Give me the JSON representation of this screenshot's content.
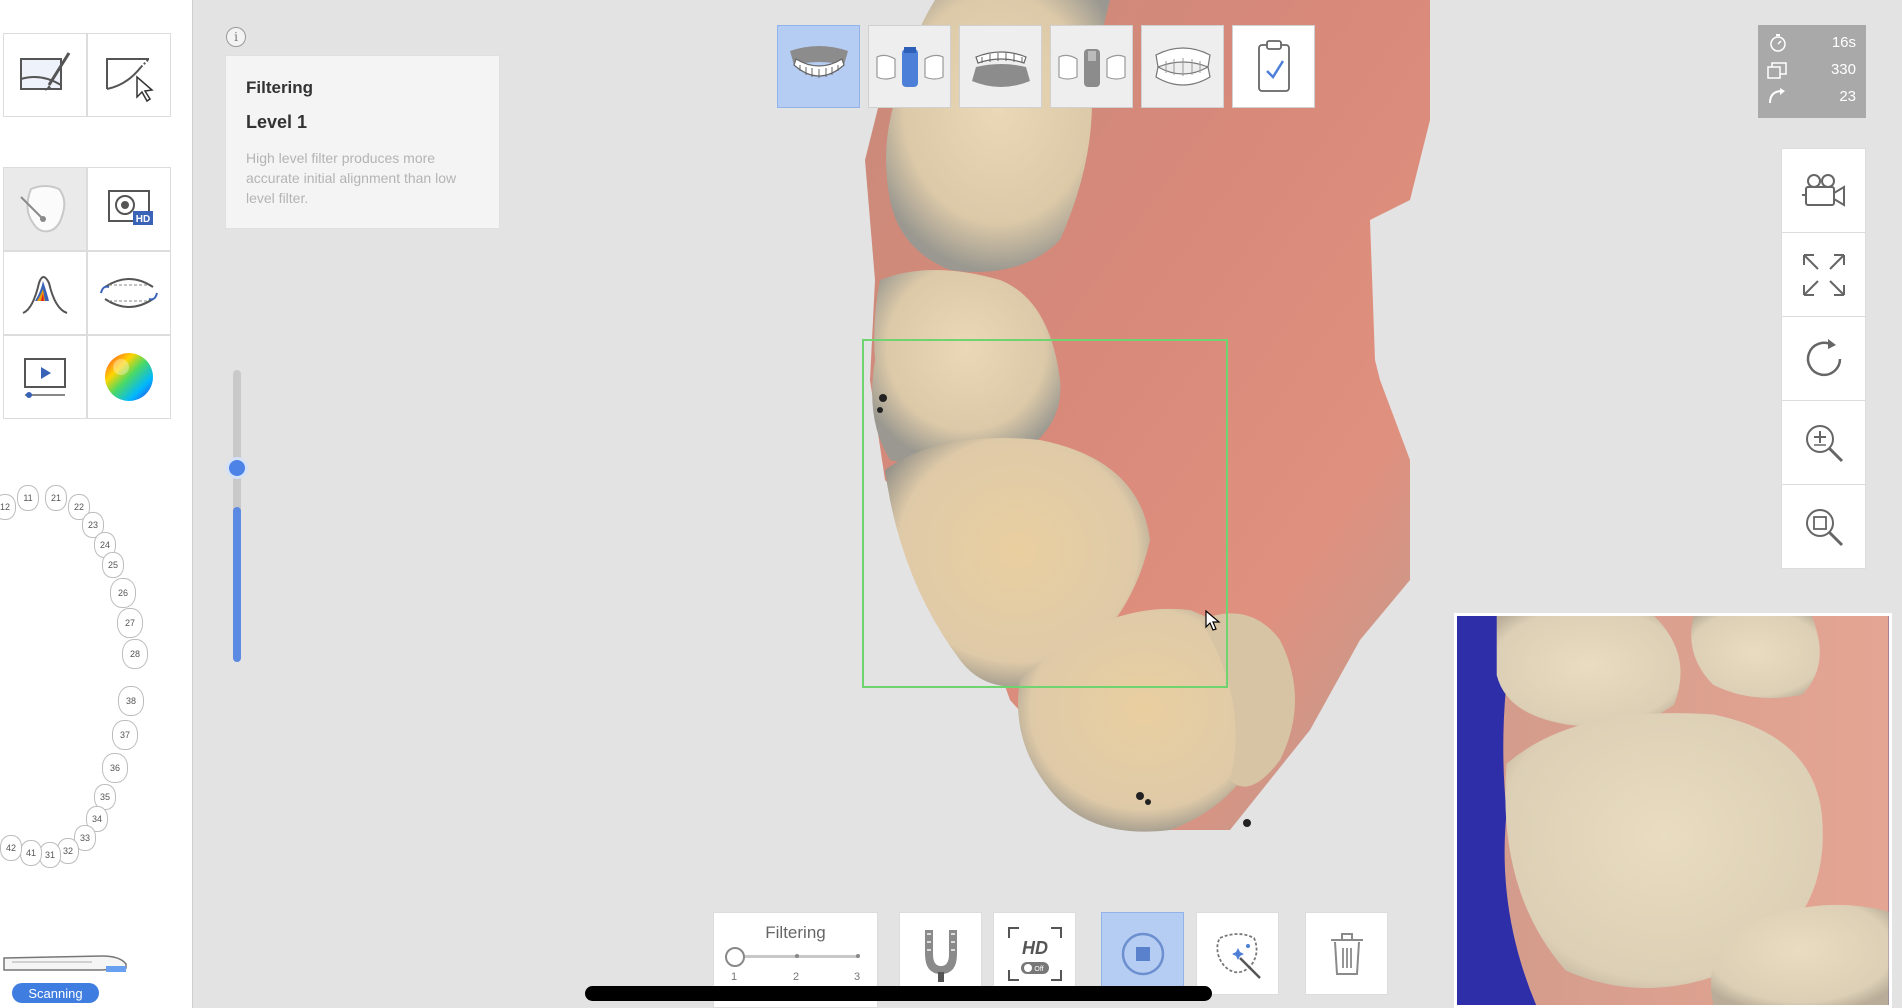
{
  "sidebar": {
    "tools": [
      {
        "icon": "edit-area-icon"
      },
      {
        "icon": "select-area-icon"
      },
      {
        "icon": "tooth-no-scan-icon"
      },
      {
        "icon": "hd-scan-icon"
      },
      {
        "icon": "shade-cone-icon"
      },
      {
        "icon": "occlusion-icon"
      },
      {
        "icon": "play-video-icon"
      },
      {
        "icon": "color-sphere-icon"
      }
    ],
    "tooth_chart": {
      "upper": [
        "12",
        "11",
        "21",
        "22",
        "23",
        "24",
        "25",
        "26",
        "27",
        "28"
      ],
      "lower": [
        "38",
        "37",
        "36",
        "35",
        "34",
        "33",
        "32",
        "31",
        "41",
        "42"
      ]
    },
    "status_badge": "Scanning"
  },
  "info_panel": {
    "info_icon": "i",
    "title": "Filtering",
    "level": "Level 1",
    "description": "High level filter produces more accurate initial alignment than low level filter."
  },
  "vertical_slider": {
    "value_fraction": 0.53
  },
  "stage_toolbar": [
    {
      "icon": "maxilla-icon",
      "active": true
    },
    {
      "icon": "maxilla-scanbody-icon",
      "active": false
    },
    {
      "icon": "mandible-icon",
      "active": false
    },
    {
      "icon": "mandible-scanbody-icon",
      "active": false
    },
    {
      "icon": "occlusion-stage-icon",
      "active": false
    },
    {
      "icon": "clipboard-check-icon",
      "active": false
    }
  ],
  "stats": [
    {
      "icon": "stopwatch-icon",
      "value": "16s"
    },
    {
      "icon": "frames-icon",
      "value": "330"
    },
    {
      "icon": "rotation-icon",
      "value": "23"
    }
  ],
  "view_tools": [
    {
      "icon": "camera-icon"
    },
    {
      "icon": "fit-screen-icon"
    },
    {
      "icon": "rotate-view-icon"
    },
    {
      "icon": "zoom-in-icon"
    },
    {
      "icon": "zoom-area-icon"
    }
  ],
  "bottom_toolbar": {
    "filter": {
      "label": "Filtering",
      "ticks": [
        "1",
        "2",
        "3"
      ],
      "value": 1
    },
    "buttons": [
      {
        "icon": "arch-tray-icon",
        "active": false
      },
      {
        "icon": "hd-toggle-icon",
        "hd_label": "HD",
        "toggle_label": "Off",
        "active": false
      },
      {
        "icon": "stop-scan-icon",
        "active": true
      },
      {
        "icon": "ai-tooth-filter-icon",
        "active": false
      },
      {
        "icon": "trash-icon",
        "active": false
      }
    ]
  },
  "colors": {
    "accent": "#4d82e6",
    "active_bg": "#b6cdf3",
    "scan_box": "#6fd46f",
    "stats_bg": "#a9a9a9",
    "preview_bg": "#2d2ea8"
  }
}
